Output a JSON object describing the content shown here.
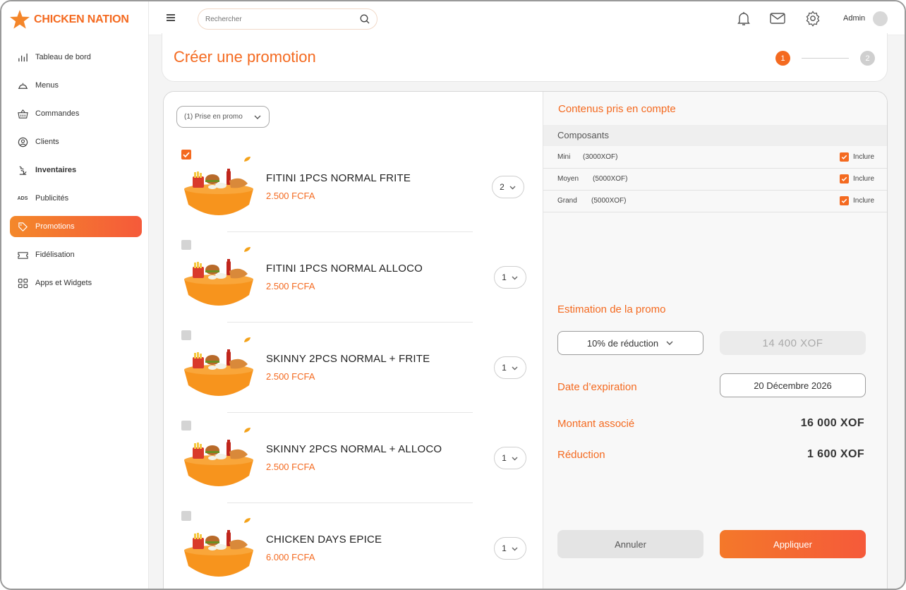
{
  "app": {
    "brand": "CHICKEN NATION",
    "colors": {
      "accent": "#f46a20",
      "accent_end": "#f55a3a",
      "inactive_step": "#cfcfcf"
    }
  },
  "sidebar": {
    "items": [
      {
        "label": "Tableau de bord",
        "icon": "bar-chart-icon"
      },
      {
        "label": "Menus",
        "icon": "cloche-icon"
      },
      {
        "label": "Commandes",
        "icon": "basket-icon"
      },
      {
        "label": "Clients",
        "icon": "user-circle-icon"
      },
      {
        "label": "Inventaires",
        "icon": "inventory-icon"
      },
      {
        "label": "Publicités",
        "icon": "ads-icon"
      },
      {
        "label": "Promotions",
        "icon": "tag-icon",
        "active": true
      },
      {
        "label": "Fidélisation",
        "icon": "ticket-icon"
      },
      {
        "label": "Apps et Widgets",
        "icon": "grid-icon"
      }
    ]
  },
  "topbar": {
    "search_placeholder": "Rechercher",
    "user_name": "Admin"
  },
  "page": {
    "title": "Créer une promotion",
    "steps": [
      "1",
      "2"
    ],
    "current_step": 1
  },
  "products": {
    "filter_label": "(1) Prise en promo",
    "items": [
      {
        "name": "FITINI 1PCS NORMAL FRITE",
        "price": "2.500 FCFA",
        "qty": "2",
        "checked": true
      },
      {
        "name": "FITINI 1PCS NORMAL ALLOCO",
        "price": "2.500 FCFA",
        "qty": "1",
        "checked": false
      },
      {
        "name": "SKINNY 2PCS NORMAL + FRITE",
        "price": "2.500 FCFA",
        "qty": "1",
        "checked": false
      },
      {
        "name": "SKINNY 2PCS NORMAL + ALLOCO",
        "price": "2.500 FCFA",
        "qty": "1",
        "checked": false
      },
      {
        "name": "CHICKEN DAYS EPICE",
        "price": "6.000 FCFA",
        "qty": "1",
        "checked": false
      }
    ]
  },
  "contents": {
    "title": "Contenus pris en compte",
    "header": "Composants",
    "include_label": "Inclure",
    "rows": [
      {
        "name": "Mini",
        "price": "(3000XOF)"
      },
      {
        "name": "Moyen",
        "price": "(5000XOF)"
      },
      {
        "name": "Grand",
        "price": "(5000XOF)"
      }
    ]
  },
  "estimation": {
    "title": "Estimation de la promo",
    "discount_option": "10% de réduction",
    "estimated_value": "14 400 XOF",
    "expiry_label": "Date d’expiration",
    "expiry_date": "20 Décembre 2026",
    "amount_label": "Montant associé",
    "amount_value": "16 000 XOF",
    "reduction_label": "Réduction",
    "reduction_value": "1 600 XOF"
  },
  "actions": {
    "cancel": "Annuler",
    "apply": "Appliquer"
  }
}
